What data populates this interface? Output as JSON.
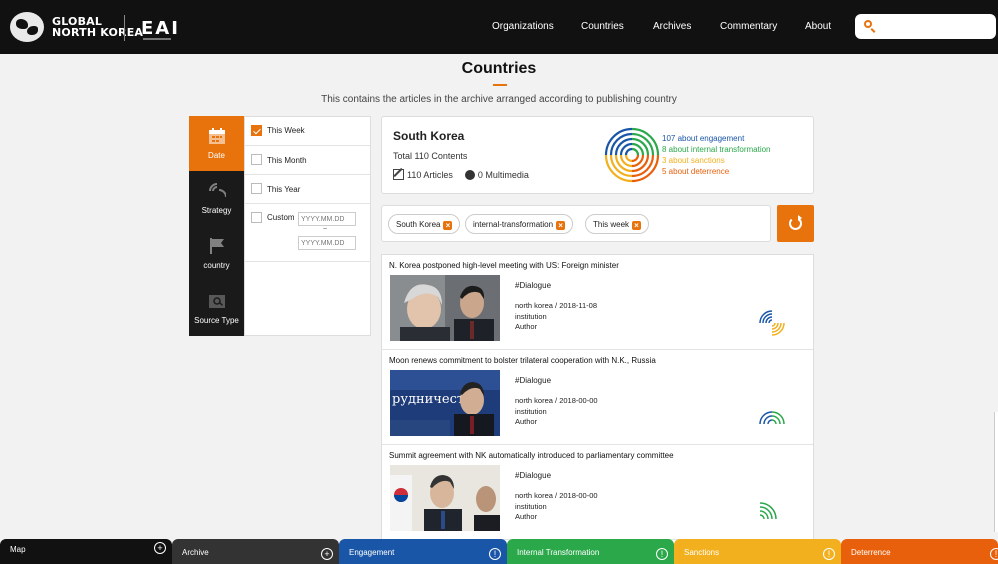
{
  "header": {
    "logo_line1": "GLOBAL",
    "logo_line2": "NORTH KOREA",
    "brand": "EAI",
    "nav": [
      "Organizations",
      "Countries",
      "Archives",
      "Commentary",
      "About"
    ],
    "search_placeholder": ""
  },
  "page": {
    "title": "Countries",
    "subtitle": "This contains the articles in the archive arranged according to publishing country"
  },
  "filters": {
    "tabs": [
      {
        "label": "Date",
        "icon": "calendar-icon",
        "active": true
      },
      {
        "label": "Strategy",
        "icon": "strategy-icon",
        "active": false
      },
      {
        "label": "country",
        "icon": "flag-icon",
        "active": false
      },
      {
        "label": "Source Type",
        "icon": "source-type-icon",
        "active": false
      }
    ],
    "options": [
      {
        "label": "This Week",
        "checked": true
      },
      {
        "label": "This Month",
        "checked": false
      },
      {
        "label": "This Year",
        "checked": false
      },
      {
        "label": "Custom",
        "checked": false
      }
    ],
    "custom_from_placeholder": "YYYY.MM.DD",
    "custom_to_placeholder": "YYYY.MM.DD",
    "range_separator": "~"
  },
  "summary": {
    "country": "South Korea",
    "total": "Total 110 Contents",
    "articles": "110 Articles",
    "multimedia": "0 Multimedia",
    "legend": [
      {
        "text": "107 about engagement",
        "color": "#1a56a8"
      },
      {
        "text": "8 about internal transformation",
        "color": "#2aa84a"
      },
      {
        "text": "3 about sanctions",
        "color": "#f2b01e"
      },
      {
        "text": "5 about deterrence",
        "color": "#e8600c"
      }
    ]
  },
  "active_tags": [
    "South Korea",
    "internal-transformation",
    "This week"
  ],
  "articles": [
    {
      "title": "N. Korea postponed high-level meeting with US: Foreign minister",
      "tag": "#Dialogue",
      "meta1": "north korea / 2018-11-08",
      "meta2": "institution",
      "meta3": "Author"
    },
    {
      "title": "Moon renews commitment to bolster trilateral cooperation with N.K., Russia",
      "tag": "#Dialogue",
      "meta1": "north korea / 2018-00-00",
      "meta2": "institution",
      "meta3": "Author",
      "thumb_caption": "рудничества"
    },
    {
      "title": "Summit agreement with NK automatically introduced to parliamentary committee",
      "tag": "#Dialogue",
      "meta1": "north korea / 2018-00-00",
      "meta2": "institution",
      "meta3": "Author"
    }
  ],
  "bottom_tabs": [
    {
      "label": "Map",
      "color": "#111111"
    },
    {
      "label": "Archive",
      "color": "#333333"
    },
    {
      "label": "Engagement",
      "color": "#1a56a8"
    },
    {
      "label": "Internal Transformation",
      "color": "#2aa84a"
    },
    {
      "label": "Sanctions",
      "color": "#f2b01e"
    },
    {
      "label": "Deterrence",
      "color": "#e8600c"
    }
  ],
  "colors": {
    "accent": "#e8720c",
    "engagement": "#1a56a8",
    "internal": "#2aa84a",
    "sanctions": "#f2b01e",
    "deterrence": "#e8600c"
  }
}
